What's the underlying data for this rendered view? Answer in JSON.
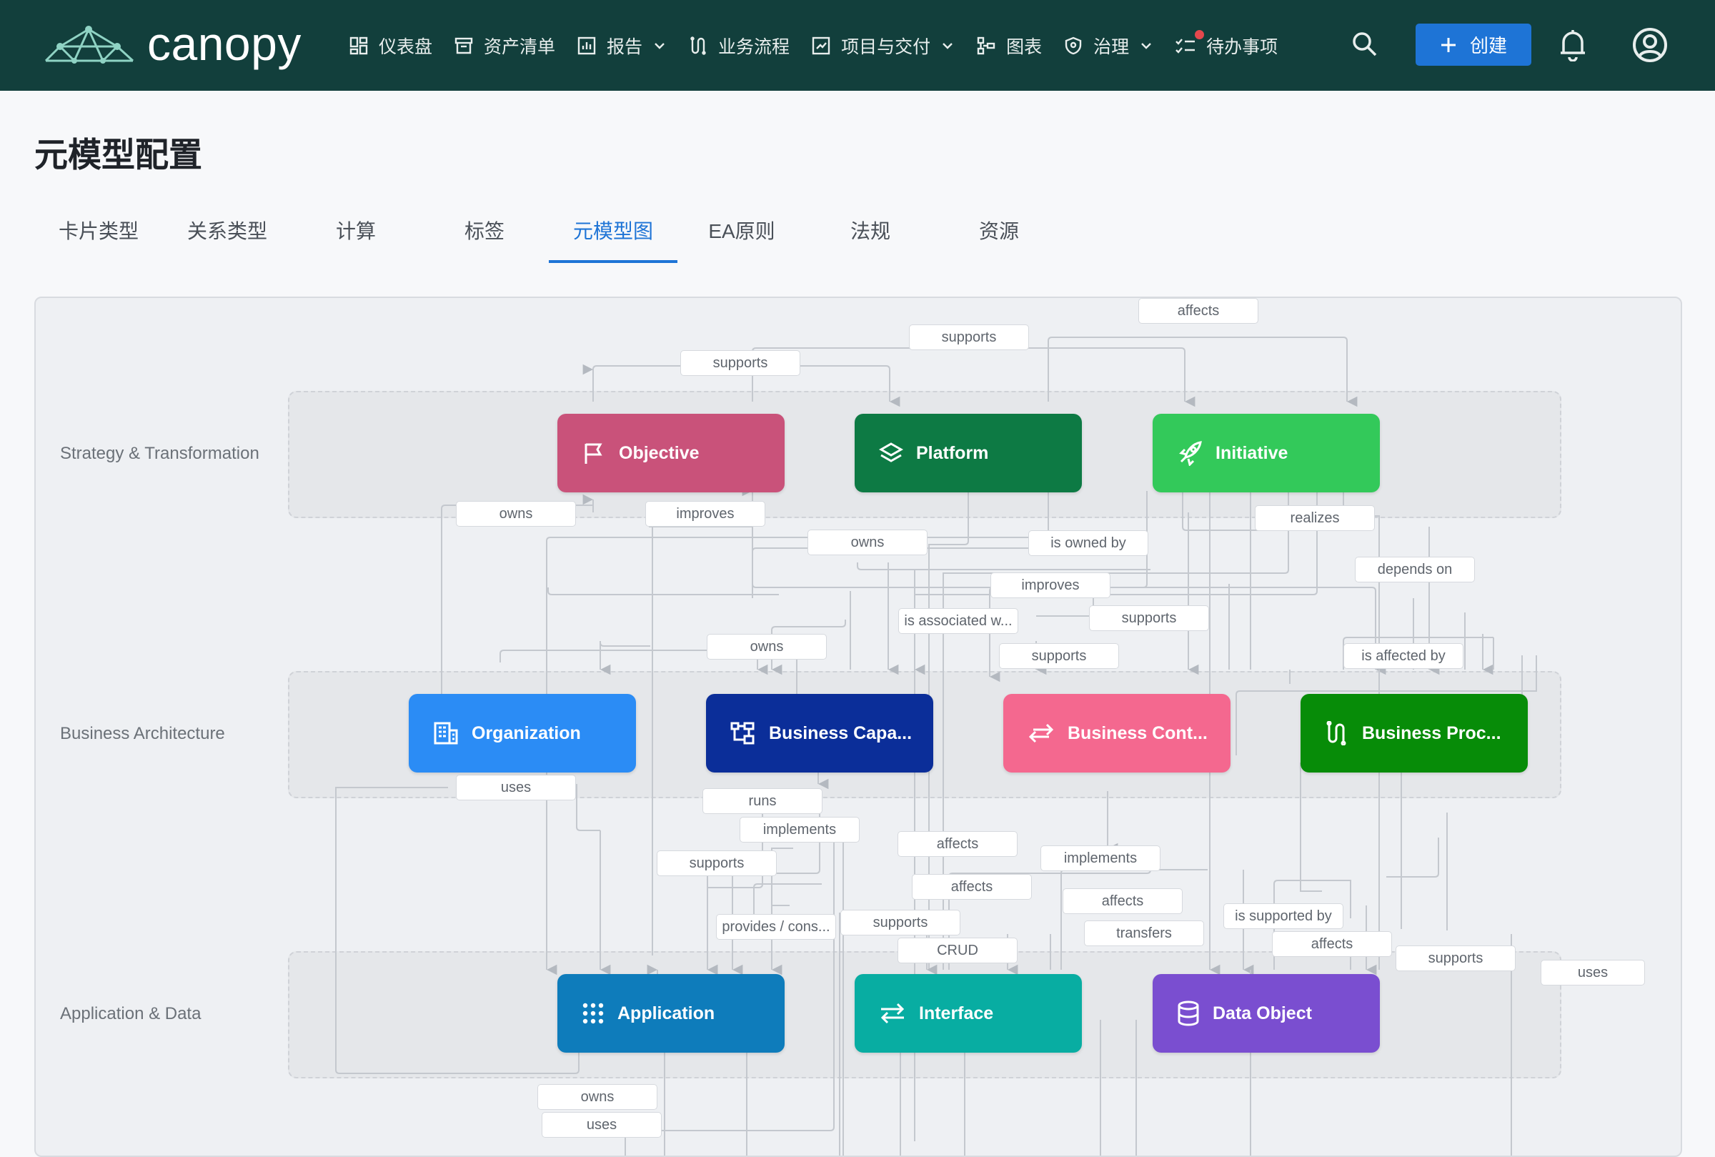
{
  "brand": {
    "name": "canopy"
  },
  "nav": [
    {
      "label": "仪表盘",
      "icon": "dashboard-icon"
    },
    {
      "label": "资产清单",
      "icon": "archive-icon"
    },
    {
      "label": "报告",
      "icon": "report-icon",
      "dropdown": true
    },
    {
      "label": "业务流程",
      "icon": "process-icon"
    },
    {
      "label": "项目与交付",
      "icon": "project-icon",
      "dropdown": true
    },
    {
      "label": "图表",
      "icon": "diagram-icon"
    },
    {
      "label": "治理",
      "icon": "shield-icon",
      "dropdown": true
    },
    {
      "label": "待办事项",
      "icon": "todo-icon",
      "badge": true
    }
  ],
  "header": {
    "create_label": "创建"
  },
  "page": {
    "title": "元模型配置"
  },
  "tabs": [
    "卡片类型",
    "关系类型",
    "计算",
    "标签",
    "元模型图",
    "EA原则",
    "法规",
    "资源"
  ],
  "active_tab": "元模型图",
  "lanes": [
    "Strategy & Transformation",
    "Business Architecture",
    "Application & Data"
  ],
  "nodes": [
    {
      "label": "Objective",
      "icon": "flag-icon",
      "color": "#c9527a"
    },
    {
      "label": "Platform",
      "icon": "layers-icon",
      "color": "#0d7a44"
    },
    {
      "label": "Initiative",
      "icon": "rocket-icon",
      "color": "#33c95a"
    },
    {
      "label": "Organization",
      "icon": "building-icon",
      "color": "#2b8cf5"
    },
    {
      "label": "Business Capa...",
      "icon": "capability-icon",
      "color": "#0b2e99"
    },
    {
      "label": "Business Cont...",
      "icon": "exchange-icon",
      "color": "#f4688f"
    },
    {
      "label": "Business Proc...",
      "icon": "process-icon",
      "color": "#078c08"
    },
    {
      "label": "Application",
      "icon": "grid-icon",
      "color": "#0e7cbb"
    },
    {
      "label": "Interface",
      "icon": "swap-icon",
      "color": "#08ada2"
    },
    {
      "label": "Data Object",
      "icon": "database-icon",
      "color": "#7a4ed0"
    }
  ],
  "edge_labels": [
    "affects",
    "supports",
    "supports",
    "owns",
    "improves",
    "realizes",
    "owns",
    "is owned by",
    "depends on",
    "improves",
    "is associated w...",
    "supports",
    "owns",
    "supports",
    "is affected by",
    "uses",
    "runs",
    "implements",
    "affects",
    "supports",
    "implements",
    "affects",
    "affects",
    "is supported by",
    "provides / cons...",
    "supports",
    "transfers",
    "CRUD",
    "affects",
    "supports",
    "uses",
    "owns",
    "uses"
  ]
}
